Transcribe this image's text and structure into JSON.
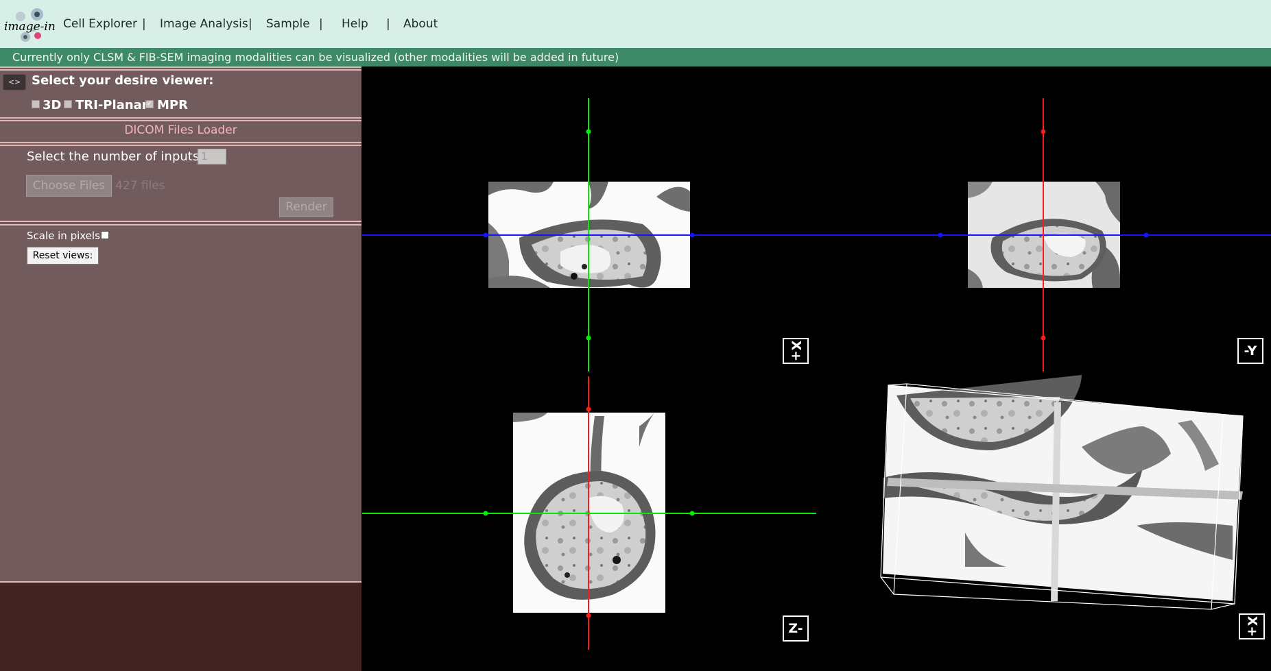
{
  "app": {
    "logo_text": "image-in"
  },
  "nav": {
    "items": [
      {
        "label": "Cell Explorer"
      },
      {
        "label": "Image Analysis"
      },
      {
        "label": "Sample"
      },
      {
        "label": "Help"
      },
      {
        "label": "About"
      }
    ],
    "separator": "|"
  },
  "notice": {
    "text": "Currently only CLSM & FIB-SEM imaging modalities can be visualized (other modalities will be added in future)"
  },
  "sidebar": {
    "collapse_icon": "<>",
    "viewer_title": "Select your desire viewer:",
    "options": [
      {
        "label": "3D",
        "checked": false
      },
      {
        "label": "TRI-Planar",
        "checked": false
      },
      {
        "label": "MPR",
        "checked": true
      }
    ],
    "loader_title": "DICOM Files Loader",
    "inputs_label": "Select the number of inputs:",
    "inputs_value": "1",
    "choose_files_label": "Choose Files",
    "files_count": "427 files",
    "render_label": "Render",
    "scale_label": "Scale in pixels:",
    "scale_checked": false,
    "reset_label": "Reset views:"
  },
  "viewer": {
    "orientation_labels": {
      "axial": "X+",
      "coronal": "-Y",
      "sagittal": "Z-",
      "volume": "X+"
    },
    "colors": {
      "x_axis": "#00ee00",
      "y_axis": "#ff0000",
      "z_axis": "#0000ff",
      "background": "#000000",
      "sidebar": "#725b5c",
      "header": "#d8efe8",
      "notice": "#3e8a68"
    }
  }
}
